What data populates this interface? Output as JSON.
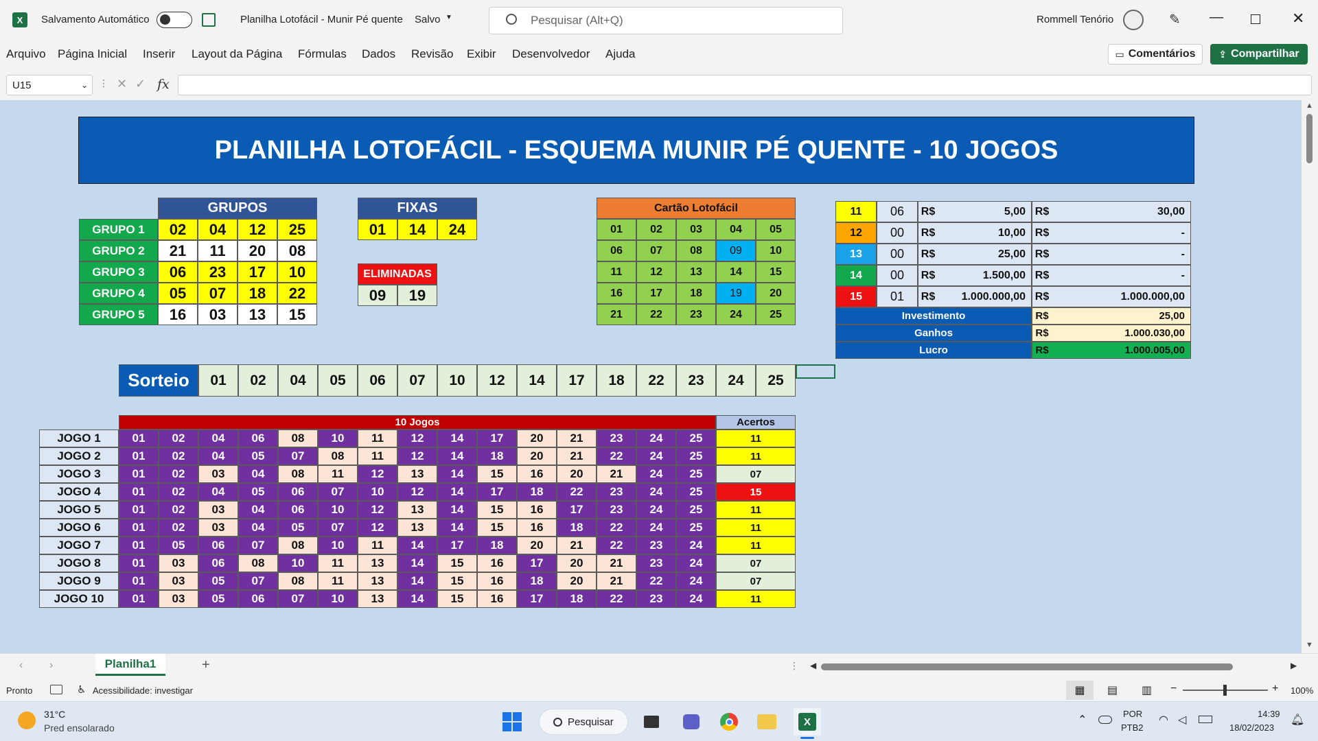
{
  "app": {
    "autosave_label": "Salvamento Automático",
    "doc_title": "Planilha Lotofácil - Munir Pé quente",
    "save_status": "Salvo",
    "search_placeholder": "Pesquisar (Alt+Q)",
    "user_name": "Rommell Tenório"
  },
  "menu": {
    "items": [
      "Arquivo",
      "Página Inicial",
      "Inserir",
      "Layout da Página",
      "Fórmulas",
      "Dados",
      "Revisão",
      "Exibir",
      "Desenvolvedor",
      "Ajuda"
    ],
    "comments_label": "Comentários",
    "share_label": "Compartilhar"
  },
  "formula_bar": {
    "name_box": "U15",
    "fx": "fx",
    "content": ""
  },
  "sheet": {
    "title": "PLANILHA LOTOFÁCIL - ESQUEMA MUNIR PÉ QUENTE - 10 JOGOS",
    "grupos": {
      "header": "GRUPOS",
      "rows": [
        {
          "label": "GRUPO 1",
          "nums": [
            "02",
            "04",
            "12",
            "25"
          ],
          "highlight": true
        },
        {
          "label": "GRUPO 2",
          "nums": [
            "21",
            "11",
            "20",
            "08"
          ],
          "highlight": false
        },
        {
          "label": "GRUPO 3",
          "nums": [
            "06",
            "23",
            "17",
            "10"
          ],
          "highlight": true
        },
        {
          "label": "GRUPO 4",
          "nums": [
            "05",
            "07",
            "18",
            "22"
          ],
          "highlight": true
        },
        {
          "label": "GRUPO 5",
          "nums": [
            "16",
            "03",
            "13",
            "15"
          ],
          "highlight": false
        }
      ]
    },
    "fixas": {
      "header": "FIXAS",
      "nums": [
        "01",
        "14",
        "24"
      ]
    },
    "eliminadas": {
      "header": "ELIMINADAS",
      "nums": [
        "09",
        "19"
      ]
    },
    "cartao": {
      "header": "Cartão Lotofácil",
      "rows": [
        [
          "01",
          "02",
          "03",
          "04",
          "05"
        ],
        [
          "06",
          "07",
          "08",
          "09",
          "10"
        ],
        [
          "11",
          "12",
          "13",
          "14",
          "15"
        ],
        [
          "16",
          "17",
          "18",
          "19",
          "20"
        ],
        [
          "21",
          "22",
          "23",
          "24",
          "25"
        ]
      ],
      "eliminated": [
        "09",
        "19"
      ]
    },
    "premios": {
      "rows": [
        {
          "hits": "11",
          "count": "06",
          "currency": "R$",
          "prize": "5,00",
          "total": "30,00",
          "color": "#ffff00"
        },
        {
          "hits": "12",
          "count": "00",
          "currency": "R$",
          "prize": "10,00",
          "total": "-",
          "color": "#ffa500"
        },
        {
          "hits": "13",
          "count": "00",
          "currency": "R$",
          "prize": "25,00",
          "total": "-",
          "color": "#1aa3e8"
        },
        {
          "hits": "14",
          "count": "00",
          "currency": "R$",
          "prize": "1.500,00",
          "total": "-",
          "color": "#12a84b"
        },
        {
          "hits": "15",
          "count": "01",
          "currency": "R$",
          "prize": "1.000.000,00",
          "total": "1.000.000,00",
          "color": "#ee1111"
        }
      ],
      "summary": [
        {
          "label": "Investimento",
          "currency": "R$",
          "value": "25,00",
          "bg": "#fff2cc"
        },
        {
          "label": "Ganhos",
          "currency": "R$",
          "value": "1.000.030,00",
          "bg": "#fff2cc"
        },
        {
          "label": "Lucro",
          "currency": "R$",
          "value": "1.000.005,00",
          "bg": "#12b050"
        }
      ]
    },
    "sorteio": {
      "label": "Sorteio",
      "nums": [
        "01",
        "02",
        "04",
        "05",
        "06",
        "07",
        "10",
        "12",
        "14",
        "17",
        "18",
        "22",
        "23",
        "24",
        "25"
      ]
    },
    "jogos": {
      "header": "10 Jogos",
      "acertos_header": "Acertos",
      "rows": [
        {
          "label": "JOGO 1",
          "nums": [
            "01",
            "02",
            "04",
            "06",
            "08",
            "10",
            "11",
            "12",
            "14",
            "17",
            "20",
            "21",
            "23",
            "24",
            "25"
          ],
          "acertos": "11"
        },
        {
          "label": "JOGO 2",
          "nums": [
            "01",
            "02",
            "04",
            "05",
            "07",
            "08",
            "11",
            "12",
            "14",
            "18",
            "20",
            "21",
            "22",
            "24",
            "25"
          ],
          "acertos": "11"
        },
        {
          "label": "JOGO 3",
          "nums": [
            "01",
            "02",
            "03",
            "04",
            "08",
            "11",
            "12",
            "13",
            "14",
            "15",
            "16",
            "20",
            "21",
            "24",
            "25"
          ],
          "acertos": "07"
        },
        {
          "label": "JOGO 4",
          "nums": [
            "01",
            "02",
            "04",
            "05",
            "06",
            "07",
            "10",
            "12",
            "14",
            "17",
            "18",
            "22",
            "23",
            "24",
            "25"
          ],
          "acertos": "15"
        },
        {
          "label": "JOGO 5",
          "nums": [
            "01",
            "02",
            "03",
            "04",
            "06",
            "10",
            "12",
            "13",
            "14",
            "15",
            "16",
            "17",
            "23",
            "24",
            "25"
          ],
          "acertos": "11"
        },
        {
          "label": "JOGO 6",
          "nums": [
            "01",
            "02",
            "03",
            "04",
            "05",
            "07",
            "12",
            "13",
            "14",
            "15",
            "16",
            "18",
            "22",
            "24",
            "25"
          ],
          "acertos": "11"
        },
        {
          "label": "JOGO 7",
          "nums": [
            "01",
            "05",
            "06",
            "07",
            "08",
            "10",
            "11",
            "14",
            "17",
            "18",
            "20",
            "21",
            "22",
            "23",
            "24"
          ],
          "acertos": "11"
        },
        {
          "label": "JOGO 8",
          "nums": [
            "01",
            "03",
            "06",
            "08",
            "10",
            "11",
            "13",
            "14",
            "15",
            "16",
            "17",
            "20",
            "21",
            "23",
            "24"
          ],
          "acertos": "07"
        },
        {
          "label": "JOGO 9",
          "nums": [
            "01",
            "03",
            "05",
            "07",
            "08",
            "11",
            "13",
            "14",
            "15",
            "16",
            "18",
            "20",
            "21",
            "22",
            "24"
          ],
          "acertos": "07"
        },
        {
          "label": "JOGO 10",
          "nums": [
            "01",
            "03",
            "05",
            "06",
            "07",
            "10",
            "13",
            "14",
            "15",
            "16",
            "17",
            "18",
            "22",
            "23",
            "24"
          ],
          "acertos": "11"
        }
      ]
    }
  },
  "sheet_tabs": {
    "active": "Planilha1"
  },
  "status": {
    "ready": "Pronto",
    "accessibility": "Acessibilidade: investigar",
    "zoom": "100%"
  },
  "taskbar": {
    "temp": "31°C",
    "weather": "Pred ensolarado",
    "search": "Pesquisar",
    "lang1": "POR",
    "lang2": "PTB2",
    "time": "14:39",
    "date": "18/02/2023"
  },
  "colors": {
    "header_blue": "#0a5bb3",
    "group_green": "#12a84b",
    "purple": "#7030a0",
    "pale_pink": "#fce4d6",
    "yellow": "#ffff00",
    "red": "#ee1111",
    "excel_green": "#1e7145"
  }
}
